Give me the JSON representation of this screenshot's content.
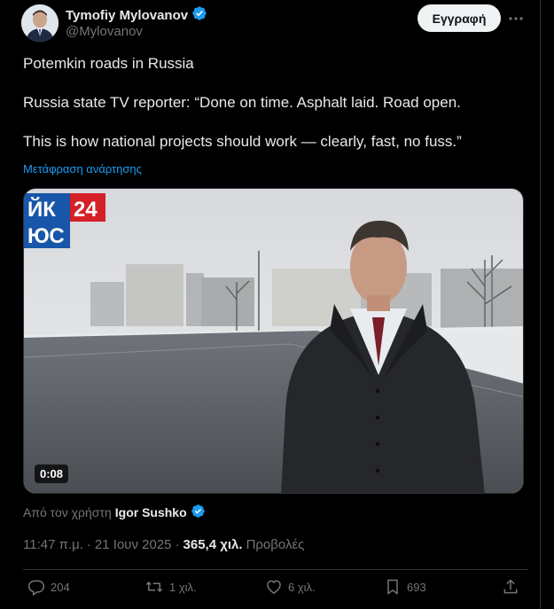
{
  "author": {
    "display_name": "Tymofiy Mylovanov",
    "handle": "@Mylovanov",
    "verified": true
  },
  "follow_button": "Εγγραφή",
  "icons": {
    "more": "more-icon",
    "verified": "verified-badge-icon",
    "reply": "reply-icon",
    "retweet": "retweet-icon",
    "like": "heart-icon",
    "bookmark": "bookmark-icon",
    "share": "share-icon"
  },
  "tweet": {
    "line1": "Potemkin roads in Russia",
    "line2": "Russia state TV reporter: “Done on time. Asphalt laid. Road open.",
    "line3": "This is how national projects should work — clearly, fast, no fuss.”",
    "translate_label": "Μετάφραση ανάρτησης"
  },
  "media": {
    "channel_logo_text1": "ЙК",
    "channel_logo_number": "24",
    "channel_logo_text2": "ЮС",
    "duration": "0:08"
  },
  "attribution": {
    "prefix": "Από τον χρήστη",
    "user": "Igor Sushko"
  },
  "meta": {
    "time": "11:47 π.μ.",
    "separator": "·",
    "date": "21 Ιουν 2025",
    "views_count": "365,4 χιλ.",
    "views_label": "Προβολές"
  },
  "stats": {
    "replies": "204",
    "reposts": "1 χιλ.",
    "likes": "6 χιλ.",
    "bookmarks": "693"
  },
  "colors": {
    "background": "#000000",
    "accent": "#1d9bf0",
    "text": "#e7e9ea",
    "muted": "#71767b",
    "divider": "#2f3336"
  }
}
